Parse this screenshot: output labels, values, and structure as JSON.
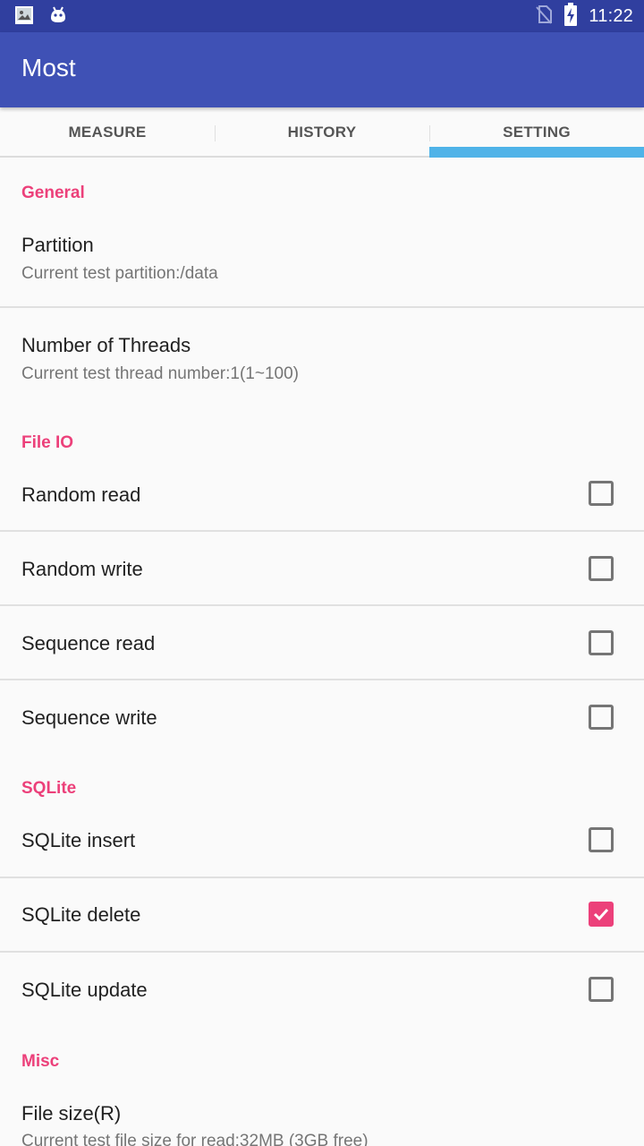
{
  "status_bar": {
    "time": "11:22",
    "icons": [
      "image-notification-icon",
      "android-notification-icon",
      "no-sim-icon",
      "battery-charging-icon"
    ]
  },
  "app_bar": {
    "title": "Most"
  },
  "tabs": [
    {
      "label": "MEASURE",
      "selected": false
    },
    {
      "label": "HISTORY",
      "selected": false
    },
    {
      "label": "SETTING",
      "selected": true
    }
  ],
  "colors": {
    "primary": "#3f51b5",
    "primary_dark": "#303f9f",
    "accent": "#ec407a",
    "tab_indicator": "#4fb3e8"
  },
  "sections": {
    "general": {
      "header": "General",
      "partition": {
        "title": "Partition",
        "summary": "Current test partition:/data"
      },
      "threads": {
        "title": "Number of Threads",
        "summary": "Current test thread number:1(1~100)"
      }
    },
    "file_io": {
      "header": "File IO",
      "items": [
        {
          "title": "Random read",
          "checked": false
        },
        {
          "title": "Random write",
          "checked": false
        },
        {
          "title": "Sequence read",
          "checked": false
        },
        {
          "title": "Sequence write",
          "checked": false
        }
      ]
    },
    "sqlite": {
      "header": "SQLite",
      "items": [
        {
          "title": "SQLite insert",
          "checked": false
        },
        {
          "title": "SQLite delete",
          "checked": true
        },
        {
          "title": "SQLite update",
          "checked": false
        }
      ]
    },
    "misc": {
      "header": "Misc",
      "file_size": {
        "title": "File size(R)",
        "summary": "Current test file size for read:32MB (3GB free)"
      }
    }
  }
}
